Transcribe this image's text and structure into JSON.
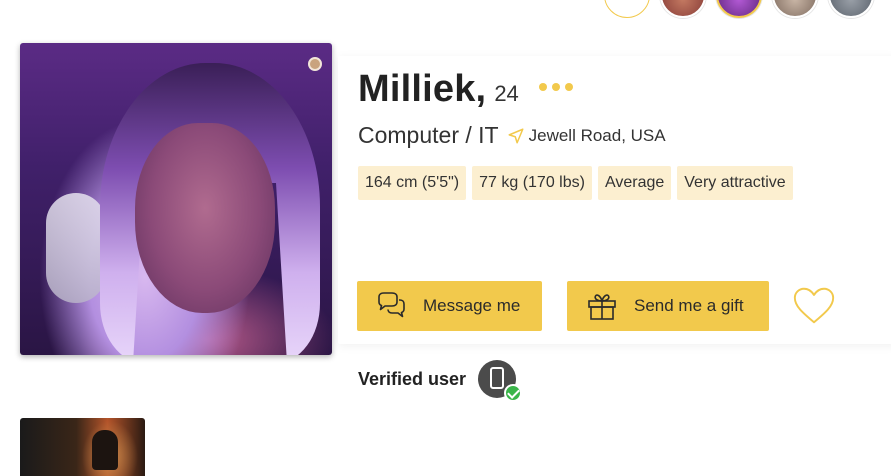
{
  "profile": {
    "name": "Milliek,",
    "age": "24",
    "job": "Computer / IT",
    "location": "Jewell Road, USA",
    "tags": [
      "164 cm (5'5\")",
      "77 kg (170 lbs)",
      "Average",
      "Very attractive"
    ]
  },
  "actions": {
    "message_label": "Message me",
    "gift_label": "Send me a gift"
  },
  "verification": {
    "label": "Verified user"
  },
  "icons": {
    "more": "more-dots-icon",
    "location": "location-arrow-icon",
    "message": "chat-bubbles-icon",
    "gift": "gift-icon",
    "favorite": "heart-icon",
    "verified": "phone-verified-icon"
  },
  "colors": {
    "accent": "#f2c94c",
    "tag_bg": "#fcefd0",
    "verified_check": "#3bb54a"
  }
}
